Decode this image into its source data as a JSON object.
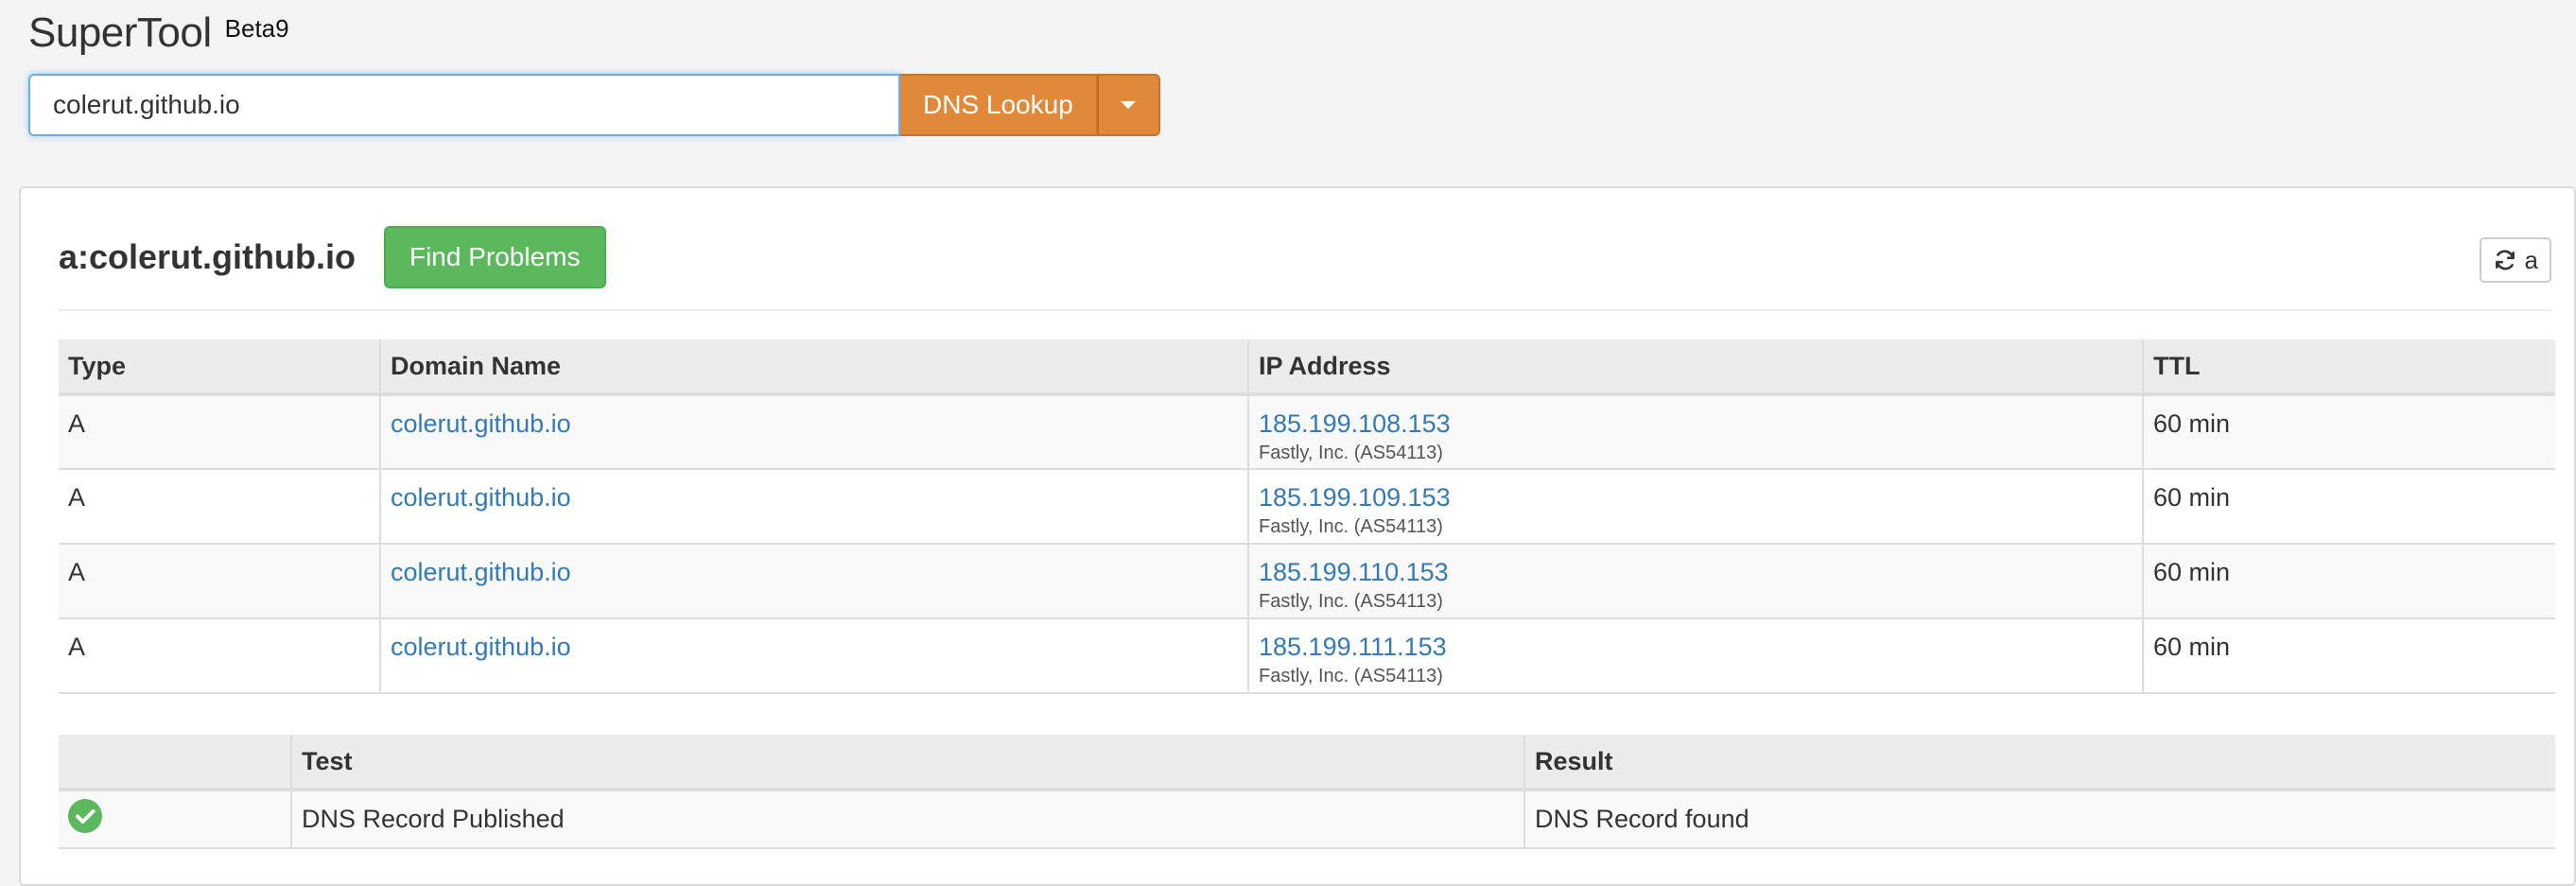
{
  "header": {
    "brand": "SuperTool",
    "beta": "Beta9",
    "search_value": "colerut.github.io",
    "lookup_label": "DNS Lookup"
  },
  "panel": {
    "title": "a:colerut.github.io",
    "find_problems_label": "Find Problems",
    "refresh_label": "a"
  },
  "dns_table": {
    "headers": [
      "Type",
      "Domain Name",
      "IP Address",
      "TTL"
    ],
    "rows": [
      {
        "type": "A",
        "domain": "colerut.github.io",
        "ip": "185.199.108.153",
        "asn": "Fastly, Inc. (AS54113)",
        "ttl": "60 min"
      },
      {
        "type": "A",
        "domain": "colerut.github.io",
        "ip": "185.199.109.153",
        "asn": "Fastly, Inc. (AS54113)",
        "ttl": "60 min"
      },
      {
        "type": "A",
        "domain": "colerut.github.io",
        "ip": "185.199.110.153",
        "asn": "Fastly, Inc. (AS54113)",
        "ttl": "60 min"
      },
      {
        "type": "A",
        "domain": "colerut.github.io",
        "ip": "185.199.111.153",
        "asn": "Fastly, Inc. (AS54113)",
        "ttl": "60 min"
      }
    ]
  },
  "test_table": {
    "headers": [
      "",
      "Test",
      "Result"
    ],
    "rows": [
      {
        "status_icon": "check-circle-icon",
        "test": "DNS Record Published",
        "result": "DNS Record found"
      }
    ]
  },
  "colors": {
    "accent_orange": "#e0893a",
    "success_green": "#5cb85c",
    "link_blue": "#337ab7"
  }
}
